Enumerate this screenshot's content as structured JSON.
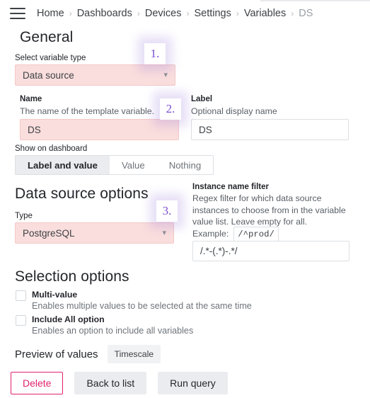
{
  "topbar": {
    "menu_icon": "hamburger-menu-icon",
    "breadcrumbs": [
      {
        "label": "Home",
        "current": false
      },
      {
        "label": "Dashboards",
        "current": false
      },
      {
        "label": "Devices",
        "current": false
      },
      {
        "label": "Settings",
        "current": false
      },
      {
        "label": "Variables",
        "current": false
      },
      {
        "label": "DS",
        "current": true
      }
    ],
    "separator": "›"
  },
  "general": {
    "heading": "General",
    "variable_type": {
      "label": "Select variable type",
      "value": "Data source",
      "chevron": "⌄"
    },
    "name": {
      "label": "Name",
      "description": "The name of the template variable.",
      "value": "DS"
    },
    "label_field": {
      "label": "Label",
      "description": "Optional display name",
      "value": "DS"
    },
    "show_on_dashboard": {
      "label": "Show on dashboard",
      "options": [
        "Label and value",
        "Value",
        "Nothing"
      ],
      "selected": "Label and value"
    }
  },
  "datasource_options": {
    "heading": "Data source options",
    "type": {
      "label": "Type",
      "value": "PostgreSQL",
      "chevron": "⌄"
    },
    "instance_name_filter": {
      "label": "Instance name filter",
      "description": "Regex filter for which data source instances to choose from in the variable value list. Leave empty for all.",
      "example_label": "Example:",
      "example_value": "/^prod/",
      "value": "/.*-(.*)-.*/"
    }
  },
  "selection_options": {
    "heading": "Selection options",
    "items": [
      {
        "title": "Multi-value",
        "description": "Enables multiple values to be selected at the same time",
        "checked": false
      },
      {
        "title": "Include All option",
        "description": "Enables an option to include all variables",
        "checked": false
      }
    ]
  },
  "preview": {
    "label": "Preview of values",
    "values": [
      "Timescale"
    ]
  },
  "actions": {
    "delete": "Delete",
    "back_to_list": "Back to list",
    "run_query": "Run query"
  },
  "annotations": [
    {
      "id": "1",
      "text": "1."
    },
    {
      "id": "2",
      "text": "2."
    },
    {
      "id": "3",
      "text": "3."
    }
  ],
  "colors": {
    "highlight_fill": "#fadedd",
    "highlight_border": "#f3c9c7",
    "danger": "#e0226e",
    "annotation": "#7b4fd0",
    "text": "#24262b",
    "muted": "#6e747a"
  }
}
